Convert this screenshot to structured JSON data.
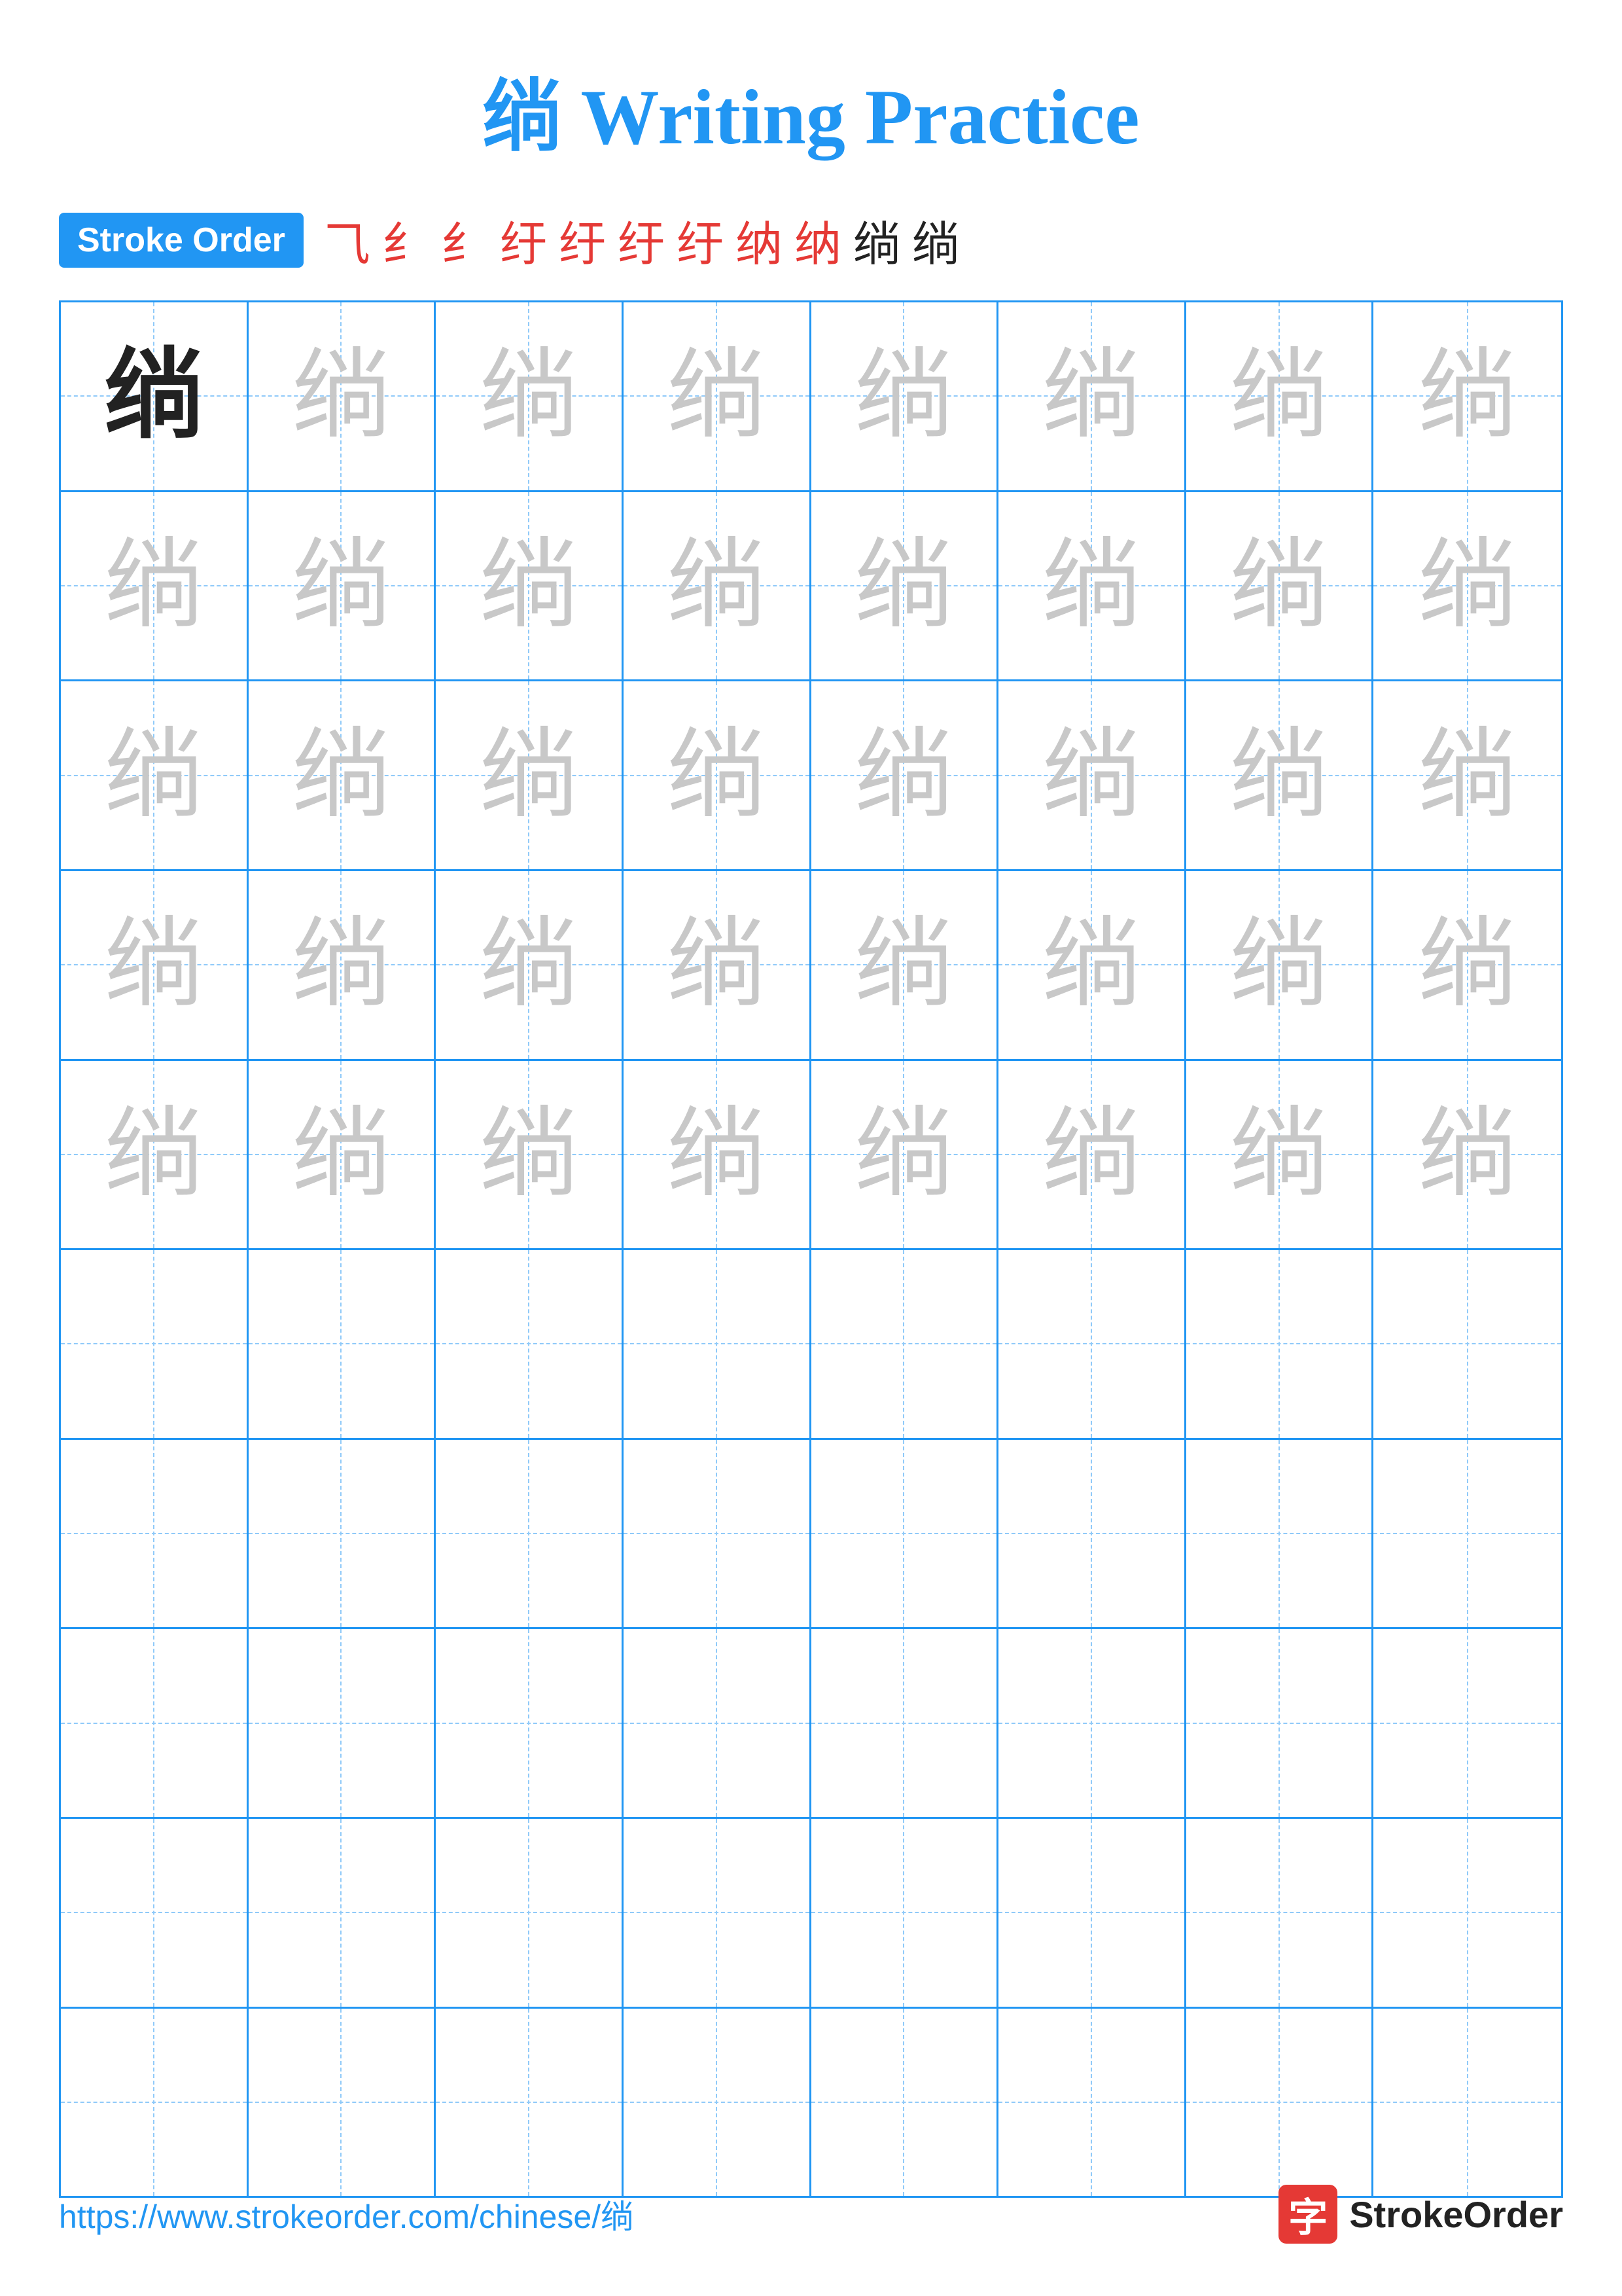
{
  "title": {
    "char": "绱",
    "text": " Writing Practice"
  },
  "stroke_order": {
    "badge_label": "Stroke Order",
    "strokes": [
      "⺄",
      "纟",
      "纟",
      "纡",
      "纡",
      "纡",
      "纡",
      "纳",
      "纳",
      "绱",
      "绱"
    ]
  },
  "grid": {
    "rows": 10,
    "cols": 8,
    "practice_char": "绱",
    "filled_rows": 5,
    "empty_rows": 5
  },
  "footer": {
    "url": "https://www.strokeorder.com/chinese/绱",
    "logo_char": "字",
    "logo_text": "StrokeOrder"
  }
}
